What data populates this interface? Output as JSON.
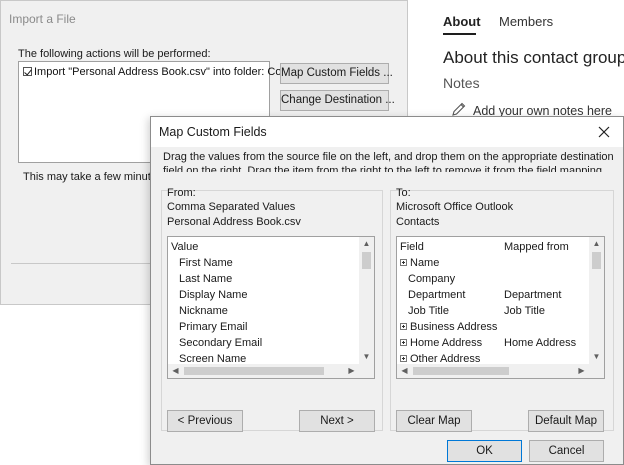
{
  "contact_group": {
    "tabs": [
      {
        "label": "About",
        "active": true
      },
      {
        "label": "Members",
        "active": false
      }
    ],
    "heading": "About this contact group",
    "notes_label": "Notes",
    "add_notes": "Add your own notes here"
  },
  "import_dialog": {
    "title": "Import a File",
    "actions_label": "The following actions will be performed:",
    "action_item": "Import \"Personal Address Book.csv\" into folder: Conta...",
    "map_button": "Map Custom Fields ...",
    "change_dest_button": "Change Destination ...",
    "status_message": "This may take a few minutes a"
  },
  "map_dialog": {
    "title": "Map Custom Fields",
    "instructions": "Drag the values from the source file on the left, and drop them on the appropriate destination field on the right.  Drag the item from the right to the left to remove it from the field mapping.",
    "from": {
      "label": "From:",
      "source_type": "Comma Separated Values",
      "source_file": "Personal Address Book.csv",
      "column_header": "Value",
      "items": [
        "First Name",
        "Last Name",
        "Display Name",
        "Nickname",
        "Primary Email",
        "Secondary Email",
        "Screen Name"
      ],
      "previous_button": "< Previous",
      "next_button": "Next >"
    },
    "to": {
      "label": "To:",
      "dest_app": "Microsoft Office Outlook",
      "dest_folder": "Contacts",
      "field_header": "Field",
      "mapped_header": "Mapped from",
      "rows": [
        {
          "field": "Name",
          "mapped": "",
          "expandable": true
        },
        {
          "field": "Company",
          "mapped": "",
          "expandable": false
        },
        {
          "field": "Department",
          "mapped": "Department",
          "expandable": false
        },
        {
          "field": "Job Title",
          "mapped": "Job Title",
          "expandable": false
        },
        {
          "field": "Business Address",
          "mapped": "",
          "expandable": true
        },
        {
          "field": "Home Address",
          "mapped": "Home Address",
          "expandable": true
        },
        {
          "field": "Other Address",
          "mapped": "",
          "expandable": true
        }
      ],
      "clear_map_button": "Clear Map",
      "default_map_button": "Default Map"
    },
    "ok_button": "OK",
    "cancel_button": "Cancel"
  }
}
